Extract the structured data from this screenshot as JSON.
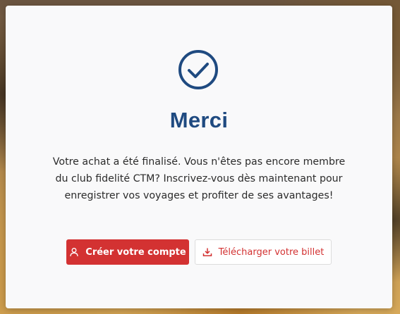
{
  "modal": {
    "icon": "check-circle-icon",
    "title": "Merci",
    "message": "Votre achat a été finalisé. Vous n'êtes pas encore membre du club fidelité CTM? Inscrivez-vous dès maintenant pour enregistrer vos voyages et profiter de ses avantages!",
    "primary_button": {
      "label": "Créer votre compte",
      "icon": "user-icon"
    },
    "secondary_button": {
      "label": "Télécharger votre billet",
      "icon": "download-icon"
    }
  },
  "colors": {
    "title": "#1f4a80",
    "accent": "#d33232",
    "background": "#f9f9fa"
  }
}
